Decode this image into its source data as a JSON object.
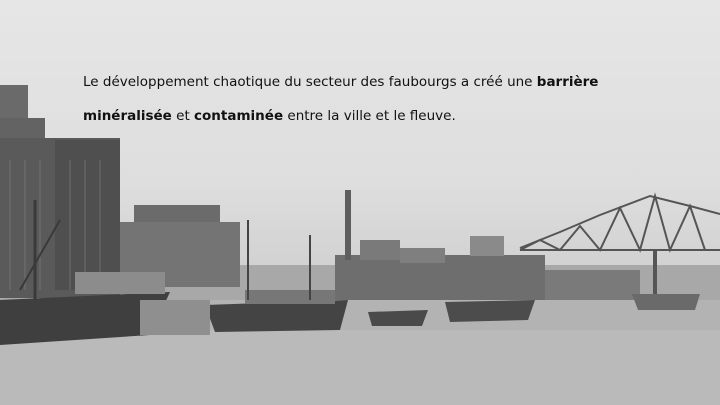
{
  "slide": {
    "caption": {
      "line1_part1": "Le développement chaotique du secteur des faubourgs a créé une ",
      "line1_bold": "barrière",
      "line2_bold1": "minéralisée",
      "line2_part1": " et ",
      "line2_bold2": "contaminée",
      "line2_part2": " entre la ville et le fleuve."
    },
    "photo": {
      "icon": "harbour-photo",
      "palette": {
        "sky": "#e2e2e2",
        "water": "#b0b0b0",
        "structures": "#555555"
      }
    }
  }
}
